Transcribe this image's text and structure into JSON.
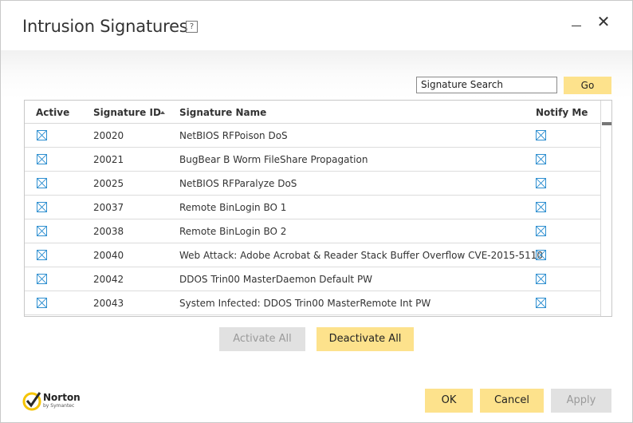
{
  "window": {
    "title": "Intrusion Signatures",
    "help_label": "?",
    "close_label": "✕"
  },
  "search": {
    "value": "Signature Search",
    "go_label": "Go"
  },
  "table": {
    "headers": {
      "active": "Active",
      "signature_id": "Signature ID",
      "signature_name": "Signature Name",
      "notify_me": "Notify Me"
    },
    "sorted_column": "Signature ID",
    "sort_direction": "ascending",
    "rows": [
      {
        "active": true,
        "id": "20020",
        "name": "NetBIOS RFPoison DoS",
        "notify": true
      },
      {
        "active": true,
        "id": "20021",
        "name": "BugBear B Worm FileShare Propagation",
        "notify": true
      },
      {
        "active": true,
        "id": "20025",
        "name": "NetBIOS RFParalyze DoS",
        "notify": true
      },
      {
        "active": true,
        "id": "20037",
        "name": "Remote BinLogin BO 1",
        "notify": true
      },
      {
        "active": true,
        "id": "20038",
        "name": "Remote BinLogin BO 2",
        "notify": true
      },
      {
        "active": true,
        "id": "20040",
        "name": "Web Attack: Adobe Acrobat & Reader Stack Buffer Overflow CVE-2015-5110",
        "notify": true
      },
      {
        "active": true,
        "id": "20042",
        "name": "DDOS Trin00 MasterDaemon Default PW",
        "notify": true
      },
      {
        "active": true,
        "id": "20043",
        "name": "System Infected: DDOS Trin00 MasterRemote Int PW",
        "notify": true
      }
    ]
  },
  "actions": {
    "activate_all": "Activate All",
    "deactivate_all": "Deactivate All"
  },
  "footer": {
    "ok": "OK",
    "cancel": "Cancel",
    "apply": "Apply",
    "logo_brand": "Norton",
    "logo_sub": "by Symantec"
  },
  "colors": {
    "accent": "#fde28c",
    "checkbox": "#2e8fd0",
    "disabled_button": "#e1e1e1"
  }
}
